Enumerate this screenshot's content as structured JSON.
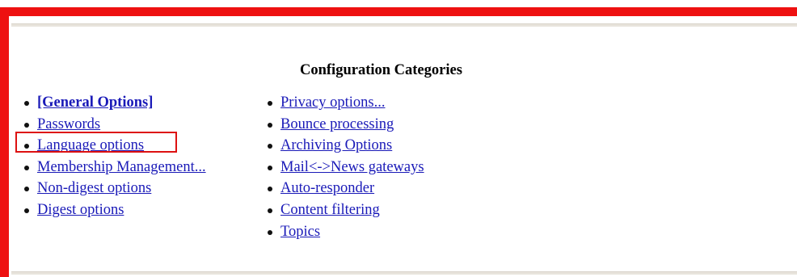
{
  "heading": "Configuration Categories",
  "left_column": [
    {
      "label": "[General Options]",
      "bold": true
    },
    {
      "label": "Passwords",
      "bold": false
    },
    {
      "label": "Language options",
      "bold": false
    },
    {
      "label": "Membership Management...",
      "bold": false
    },
    {
      "label": "Non-digest options",
      "bold": false
    },
    {
      "label": "Digest options",
      "bold": false
    }
  ],
  "right_column": [
    {
      "label": "Privacy options..."
    },
    {
      "label": "Bounce processing"
    },
    {
      "label": "Archiving Options"
    },
    {
      "label": "Mail<->News gateways"
    },
    {
      "label": "Auto-responder"
    },
    {
      "label": "Content filtering"
    },
    {
      "label": "Topics"
    }
  ],
  "colors": {
    "link": "#1a1ab8",
    "frame": "#ee1111",
    "highlight": "#dd1111"
  }
}
